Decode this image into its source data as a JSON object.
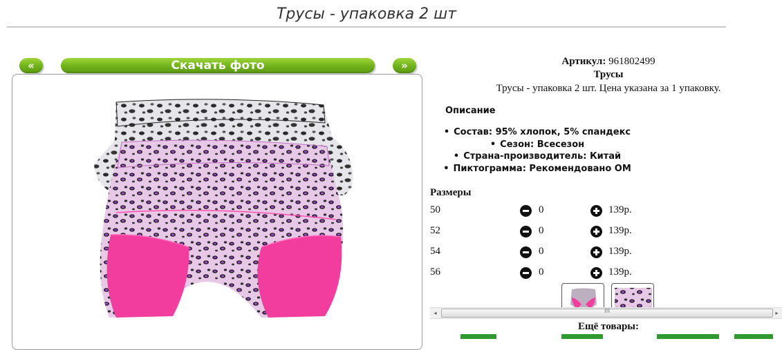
{
  "page": {
    "title": "Трусы - упаковка 2 шт"
  },
  "nav": {
    "prev_label": "«",
    "download_label": "Скачать фото",
    "next_label": "»"
  },
  "product": {
    "article_label": "Артикул:",
    "article_value": "961802499",
    "name": "Трусы",
    "short_description": "Трусы - упаковка 2 шт. Цена указана за 1 упаковку.",
    "description_heading": "Описание",
    "features": [
      "Состав: 95% хлопок, 5% спандекс",
      "Сезон: Всесезон",
      "Страна-производитель: Китай",
      "Пиктограмма: Рекомендовано ОМ"
    ]
  },
  "sizes": {
    "heading": "Размеры",
    "rows": [
      {
        "size": "50",
        "qty": "0",
        "price": "139р."
      },
      {
        "size": "52",
        "qty": "0",
        "price": "139р."
      },
      {
        "size": "54",
        "qty": "0",
        "price": "139р."
      },
      {
        "size": "56",
        "qty": "0",
        "price": "139р."
      }
    ]
  },
  "thumbnails": {
    "count": 2,
    "selected_index": 0
  },
  "scrollbar": {
    "left_arrow": "◂",
    "right_arrow": "▸",
    "grip": "III"
  },
  "more": {
    "heading": "Ещё товары:"
  },
  "colors": {
    "accent_green": "#72b41c",
    "link_green": "#2f9a2f",
    "product_pink": "#f23c9e",
    "product_purple": "#9a3fc8"
  }
}
